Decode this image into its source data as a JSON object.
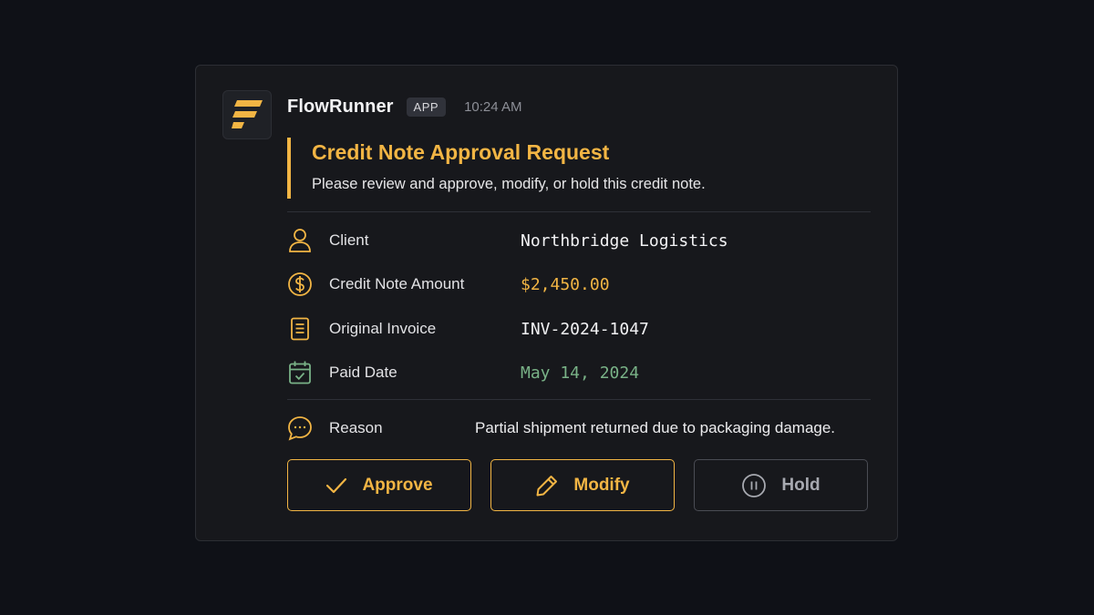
{
  "app": {
    "name": "FlowRunner",
    "badge": "APP",
    "timestamp": "10:24 AM",
    "logo_icon": "flowrunner-logo"
  },
  "message": {
    "title": "Credit Note Approval Request",
    "subtitle": "Please review and approve, modify, or hold this credit note."
  },
  "fields": [
    {
      "icon": "user-icon",
      "label": "Client",
      "value": "Northbridge Logistics"
    },
    {
      "icon": "dollar-circle-icon",
      "label": "Credit Note Amount",
      "value": "$2,450.00"
    },
    {
      "icon": "document-icon",
      "label": "Original Invoice",
      "value": "INV-2024-1047"
    },
    {
      "icon": "calendar-check-icon",
      "label": "Paid Date",
      "value": "May 14, 2024"
    }
  ],
  "reason": {
    "icon": "chat-bubble-icon",
    "label": "Reason",
    "value": "Partial shipment returned due to packaging damage."
  },
  "actions": {
    "approve": {
      "label": "Approve",
      "icon": "check-icon"
    },
    "modify": {
      "label": "Modify",
      "icon": "pencil-icon"
    },
    "hold": {
      "label": "Hold",
      "icon": "pause-circle-icon"
    }
  },
  "colors": {
    "accent": "#f2b544",
    "date_green": "#79b287",
    "background": "#0f1117",
    "card": "#17181c"
  }
}
